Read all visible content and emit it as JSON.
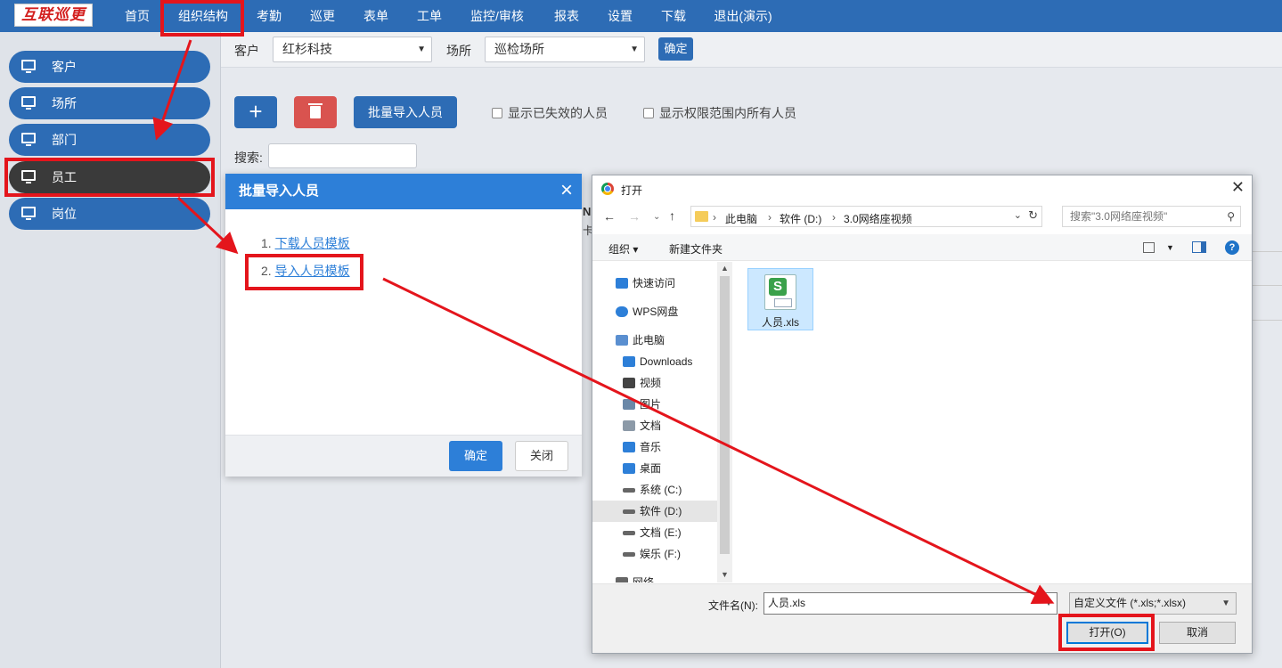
{
  "app": {
    "logo": "互联巡更"
  },
  "nav": [
    {
      "label": "首页"
    },
    {
      "label": "组织结构"
    },
    {
      "label": "考勤"
    },
    {
      "label": "巡更"
    },
    {
      "label": "表单"
    },
    {
      "label": "工单"
    },
    {
      "label": "监控/审核"
    },
    {
      "label": "报表"
    },
    {
      "label": "设置"
    },
    {
      "label": "下载"
    },
    {
      "label": "退出(演示)"
    }
  ],
  "sidebar": {
    "items": [
      {
        "label": "客户"
      },
      {
        "label": "场所"
      },
      {
        "label": "部门"
      },
      {
        "label": "员工",
        "active": true
      },
      {
        "label": "岗位"
      }
    ]
  },
  "filter": {
    "customer_label": "客户",
    "customer_value": "红杉科技",
    "site_label": "场所",
    "site_value": "巡检场所",
    "confirm": "确定"
  },
  "toolbar": {
    "add_icon": "+",
    "import": "批量导入人员",
    "chk_invalid": "显示已失效的人员",
    "chk_all": "显示权限范围内所有人员",
    "search_label": "搜索:"
  },
  "modal": {
    "title": "批量导入人员",
    "close_icon": "×",
    "step1_num": "1.",
    "step1_link": "下载人员模板",
    "step2_num": "2.",
    "step2_link": "导入人员模板",
    "ok": "确定",
    "close": "关闭"
  },
  "file_dialog": {
    "title": "打开",
    "close_icon": "✕",
    "breadcrumb": [
      "此电脑",
      "软件 (D:)",
      "3.0网络座视频"
    ],
    "search_placeholder": "搜索\"3.0网络座视频\"",
    "organize": "组织 ▾",
    "new_folder": "新建文件夹",
    "tree": [
      {
        "label": "快速访问",
        "icon": "star-icon",
        "color": "#2d7fd8"
      },
      {
        "label": "WPS网盘",
        "icon": "cloud-icon",
        "color": "#2d7fd8"
      },
      {
        "label": "此电脑",
        "icon": "computer-icon",
        "color": "#5a8fd0"
      },
      {
        "label": "Downloads",
        "icon": "download-icon",
        "color": "#2d7fd8"
      },
      {
        "label": "视频",
        "icon": "video-icon",
        "color": "#444444"
      },
      {
        "label": "图片",
        "icon": "picture-icon",
        "color": "#6a88a8"
      },
      {
        "label": "文档",
        "icon": "document-icon",
        "color": "#8c9aa8"
      },
      {
        "label": "音乐",
        "icon": "music-icon",
        "color": "#2d7fd8"
      },
      {
        "label": "桌面",
        "icon": "desktop-icon",
        "color": "#2d7fd8"
      },
      {
        "label": "系统 (C:)",
        "icon": "drive-icon",
        "color": "#666666"
      },
      {
        "label": "软件 (D:)",
        "icon": "drive-icon",
        "color": "#666666",
        "selected": true
      },
      {
        "label": "文档 (E:)",
        "icon": "drive-icon",
        "color": "#666666"
      },
      {
        "label": "娱乐 (F:)",
        "icon": "drive-icon",
        "color": "#666666"
      },
      {
        "label": "网络",
        "icon": "network-icon",
        "color": "#666666"
      }
    ],
    "file": {
      "name": "人员.xls",
      "icon_letter": "S"
    },
    "filename_label": "文件名(N):",
    "filename_value": "人员.xls",
    "filetype": "自定义文件 (*.xls;*.xlsx)",
    "open": "打开(O)",
    "cancel": "取消"
  },
  "background": {
    "peek_n": "N",
    "peek_k": "卡"
  },
  "colors": {
    "primary": "#2d6cb5",
    "danger": "#d9534f",
    "annotation": "#e4151c"
  }
}
